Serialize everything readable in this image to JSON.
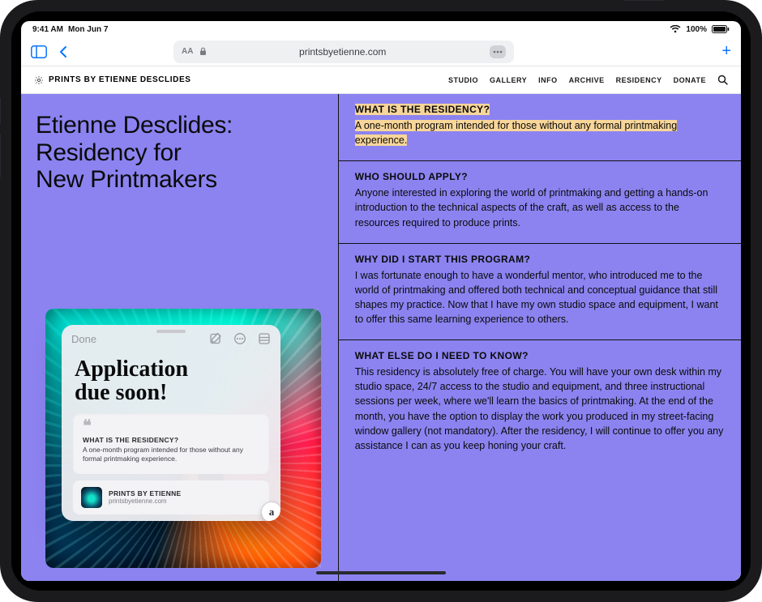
{
  "statusbar": {
    "time": "9:41 AM",
    "date": "Mon Jun 7",
    "battery_pct": "100%"
  },
  "toolbar": {
    "url": "printsbyetienne.com"
  },
  "site": {
    "title": "PRINTS BY ETIENNE DESCLIDES",
    "nav": {
      "studio": "STUDIO",
      "gallery": "GALLERY",
      "info": "INFO",
      "archive": "ARCHIVE",
      "residency": "RESIDENCY",
      "donate": "DONATE"
    }
  },
  "page": {
    "heading": "Etienne Desclides:\nResidency for\nNew Printmakers",
    "blocks": {
      "what": {
        "h": "WHAT IS THE RESIDENCY?",
        "p": "A one-month program intended for those without any formal printmaking experience."
      },
      "who": {
        "h": "WHO SHOULD APPLY?",
        "p": "Anyone interested in exploring the world of printmaking and getting a hands-on introduction to the technical aspects of the craft, as well as access to the resources required to produce prints."
      },
      "why": {
        "h": "WHY DID I START THIS PROGRAM?",
        "p": "I was fortunate enough to have a wonderful mentor, who introduced me to the world of printmaking and offered both technical and conceptual guidance that still shapes my practice. Now that I have my own studio space and equipment, I want to offer this same learning experience to others."
      },
      "else": {
        "h": "WHAT ELSE DO I NEED TO KNOW?",
        "p": "This residency is absolutely free of charge. You will have your own desk within my studio space, 24/7 access to the studio and equipment, and three instructional sessions per week, where we'll learn the basics of printmaking. At the end of the month, you have the option to display the work you produced in my street-facing window gallery (not mandatory). After the residency, I will continue to offer you any assistance I can as you keep honing your craft."
      }
    }
  },
  "note": {
    "done": "Done",
    "ink": "Application\n     due soon!",
    "quote_heading": "WHAT IS THE RESIDENCY?",
    "quote_text": "A one-month program intended for those without any formal printmaking experience.",
    "source_title": "PRINTS BY ETIENNE",
    "source_url": "printsbyetienne.com"
  }
}
